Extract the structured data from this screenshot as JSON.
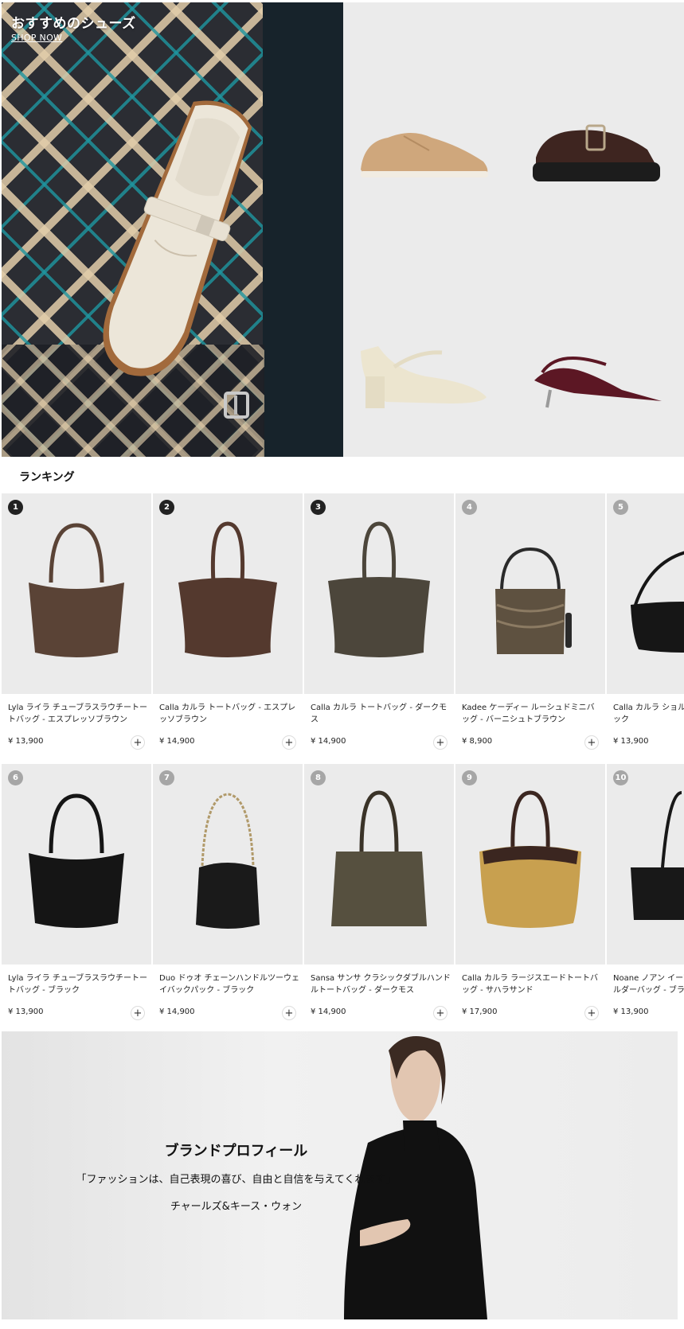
{
  "hero": {
    "title": "おすすめのシューズ",
    "link": "SHOP NOW"
  },
  "ranking": {
    "title": "ランキング",
    "add_label": "+",
    "products": [
      {
        "rank": "1",
        "name": "Lyla ライラ チューブラスラウチートートバッグ - エスプレッソブラウン",
        "price": "¥ 13,900",
        "color": "#5a4336"
      },
      {
        "rank": "2",
        "name": "Calla カルラ トートバッグ - エスプレッソブラウン",
        "price": "¥ 14,900",
        "color": "#54392e"
      },
      {
        "rank": "3",
        "name": "Calla カルラ トートバッグ - ダークモス",
        "price": "¥ 14,900",
        "color": "#4c463b"
      },
      {
        "rank": "4",
        "name": "Kadee ケーディー ルーシュドミニバッグ - バーニシュトブラウン",
        "price": "¥ 8,900",
        "color": "#5e5140"
      },
      {
        "rank": "5",
        "name": "Calla カルラ ショルダーバッグ - ブラック",
        "price": "¥ 13,900",
        "color": "#161616"
      },
      {
        "rank": "6",
        "name": "Lyla ライラ チューブラスラウチートートバッグ - ブラック",
        "price": "¥ 13,900",
        "color": "#151515"
      },
      {
        "rank": "7",
        "name": "Duo ドゥオ チェーンハンドルツーウェイバックパック - ブラック",
        "price": "¥ 14,900",
        "color": "#1a1a1a"
      },
      {
        "rank": "8",
        "name": "Sansa サンサ クラシックダブルハンドルトートバッグ - ダークモス",
        "price": "¥ 14,900",
        "color": "#56503f"
      },
      {
        "rank": "9",
        "name": "Calla カルラ ラージスエードトートバッグ - サハラサンド",
        "price": "¥ 17,900",
        "color": "#c8a04f"
      },
      {
        "rank": "10",
        "name": "Noane ノアン イーブンハンドルショルダーバッグ - ブラック",
        "price": "¥ 13,900",
        "color": "#181818"
      }
    ]
  },
  "brand": {
    "title": "ブランドプロフィール",
    "quote": "「ファッションは、自己表現の喜び、自由と自信を与えてくれます」",
    "author": "チャールズ&キース・ウォン"
  }
}
